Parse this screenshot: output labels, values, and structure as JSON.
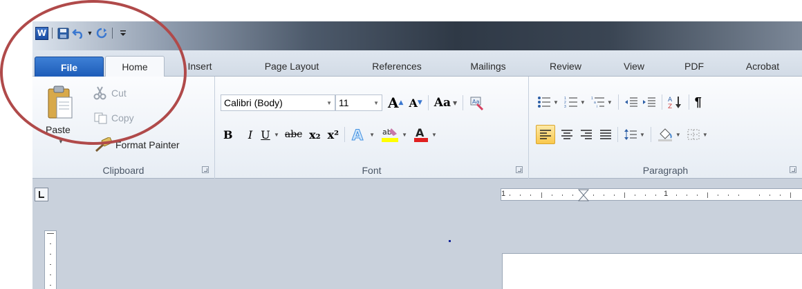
{
  "quick_access": {
    "app_icon": "word-logo-icon",
    "app_letter": "W",
    "save": "save-icon",
    "undo": "undo-icon",
    "redo": "redo-icon",
    "customize": "customize-dropdown-icon"
  },
  "tabs": [
    {
      "label": "File"
    },
    {
      "label": "Home"
    },
    {
      "label": "Insert"
    },
    {
      "label": "Page Layout"
    },
    {
      "label": "References"
    },
    {
      "label": "Mailings"
    },
    {
      "label": "Review"
    },
    {
      "label": "View"
    },
    {
      "label": "PDF"
    },
    {
      "label": "Acrobat"
    }
  ],
  "clipboard": {
    "paste": "Paste",
    "cut": "Cut",
    "copy": "Copy",
    "format_painter": "Format Painter",
    "group_label": "Clipboard"
  },
  "font": {
    "family": "Calibri (Body)",
    "size": "11",
    "change_case": "Aa",
    "bold": "B",
    "italic": "I",
    "underline": "U",
    "strikethrough": "abc",
    "subscript": "x₂",
    "superscript": "x²",
    "group_label": "Font",
    "colors": {
      "highlight": "#ffff00",
      "font_color": "#e02020"
    }
  },
  "paragraph": {
    "group_label": "Paragraph",
    "pilcrow": "¶",
    "sort": "A Z"
  },
  "ruler": {
    "numbers": [
      "1",
      "1"
    ]
  },
  "annotation": {
    "circle_color": "#b04a4a"
  }
}
